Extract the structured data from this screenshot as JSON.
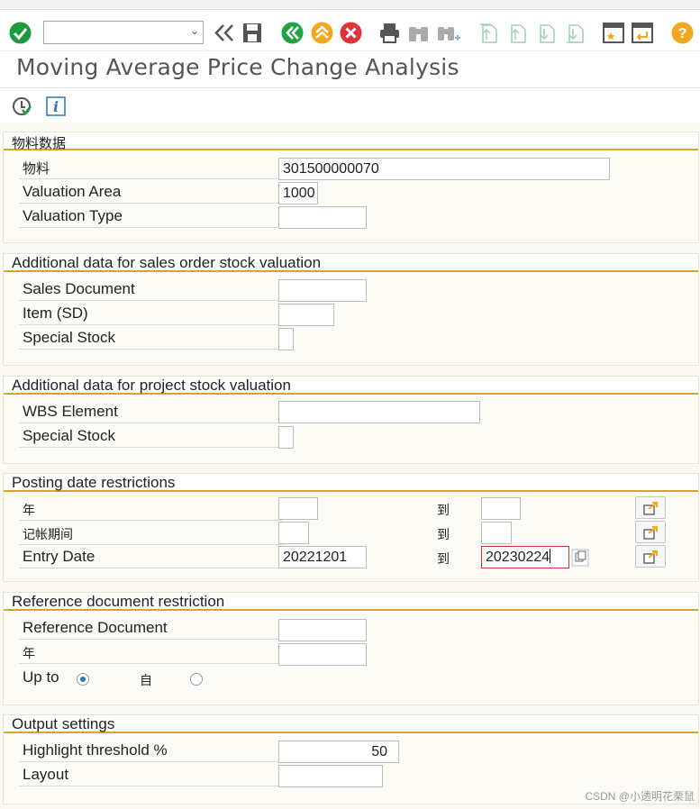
{
  "toolbar": {
    "command_field_value": "",
    "icons": [
      "enter-icon",
      "back-double-icon",
      "save-icon",
      "back-icon",
      "exit-icon",
      "cancel-icon",
      "print-icon",
      "find-icon",
      "find-next-icon",
      "first-page-icon",
      "previous-page-icon",
      "next-page-icon",
      "last-page-icon",
      "create-session-icon",
      "generate-shortcut-icon",
      "help-icon"
    ]
  },
  "title": "Moving Average Price Change Analysis",
  "sections": {
    "material": {
      "title": "物料数据",
      "material_label": "物料",
      "material_value": "301500000070",
      "valuation_area_label": "Valuation Area",
      "valuation_area_value": "1000",
      "valuation_type_label": "Valuation Type",
      "valuation_type_value": ""
    },
    "sales_order": {
      "title": "Additional data for sales order stock valuation",
      "sales_document_label": "Sales Document",
      "item_label": "Item (SD)",
      "special_stock_label": "Special Stock"
    },
    "project": {
      "title": "Additional data for project stock valuation",
      "wbs_label": "WBS Element",
      "special_stock_label": "Special Stock"
    },
    "posting": {
      "title": "Posting date restrictions",
      "year_label": "年",
      "period_label": "记帐期间",
      "entry_date_label": "Entry Date",
      "to_label": "到",
      "entry_date_from": "20221201",
      "entry_date_to": "20230224"
    },
    "reference": {
      "title": "Reference document restriction",
      "ref_doc_label": "Reference Document",
      "year_label": "年",
      "up_to_label": "Up to",
      "from_label": "自"
    },
    "output": {
      "title": "Output settings",
      "threshold_label": "Highlight threshold %",
      "threshold_value": "50",
      "layout_label": "Layout"
    }
  },
  "watermark": "CSDN @小透明花栗鼠",
  "colors": {
    "group_underline": "#d4a72c",
    "enter_green": "#1e9a3e",
    "nav_green": "#25a244",
    "exit_orange": "#f2a81d",
    "cancel_red": "#e1343a",
    "help_orange": "#f2a81d"
  }
}
